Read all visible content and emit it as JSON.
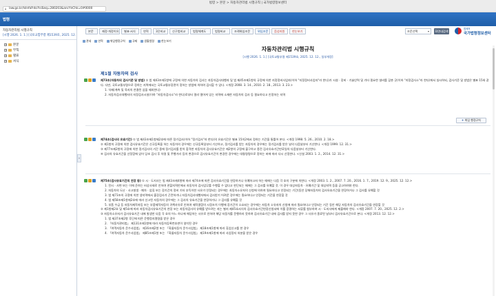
{
  "browser": {
    "tab_title": "법령 > 본문 > 자동차관리법 시행규칙 | 국가법령정보센터",
    "address": "law.go.kr/lsInfoP.do?lsiSeq=280203&ancYnChk=0#0000"
  },
  "header": {
    "menu": "법령"
  },
  "sidebar": {
    "title": "자동차관리법 시행규칙",
    "subtitle": "[시행 2026. 1. 1.] [국토교통부령 제1539호, 2025. 12.",
    "items": [
      {
        "label": "본문"
      },
      {
        "label": "부칙"
      },
      {
        "label": "별표"
      },
      {
        "label": "서식"
      }
    ],
    "collapse_icon": "«"
  },
  "toolbar": {
    "buttons": [
      {
        "label": "본문",
        "color": "normal"
      },
      {
        "label": "제정·개정이유",
        "color": "normal"
      },
      {
        "label": "별표·서식",
        "color": "normal"
      },
      {
        "label": "연혁",
        "color": "normal"
      },
      {
        "label": "3단비교",
        "color": "normal"
      },
      {
        "label": "신구법비교",
        "color": "normal"
      },
      {
        "label": "법령체계도",
        "color": "normal"
      },
      {
        "label": "법령비교",
        "color": "normal"
      },
      {
        "label": "조례위임조문",
        "color": "normal"
      },
      {
        "label": "위임조문",
        "color": "blue"
      },
      {
        "label": "음성지원",
        "color": "red"
      },
      {
        "label": "한눈보기",
        "color": "red"
      }
    ],
    "select_value": "조문선택",
    "go_label": "화면내검색",
    "logo_small": "법제처",
    "logo_main": "국가법령정보센터"
  },
  "sub_toolbar": [
    "관세",
    "연혁",
    "위임행정규칙",
    "규제",
    "생활법령",
    "한눈보기"
  ],
  "law": {
    "title": "자동차관리법 시행규칙",
    "subtitle": "[시행 2026. 1. 1.] [국토교통부령 제1539호, 2025. 12. 12., 일부개정]",
    "chapter": "제1절 자동차의 검사",
    "related_button": "위임 행정규칙"
  },
  "articles": [
    {
      "head": "제73조(자동차의 검사기준 및 방법)",
      "lines": [
        "① 법 제43조제1항에 규정에 의한 자동차의 검사는 자동차검사대행자 및 법 제45조제1항의 규정에 의한 지정정비사업자(이하 \"지정정비사업자\"라 한다)가 시설 · 장비 · 기술인력 및 기타 필요한 설비를 갖춘 곳(이하 \"지정검사소\"라 한다)에서 실시하되, 검사기준 및 방법은 별표 15와 같다. 다만, 국토교통부령으로 정하는 지역에서는 국토교통부장관이 정하는 방법에 의하여 검사할 수 있다. <개정 2008. 3. 14., 2010. 2. 18., 2013. 3. 23.>",
        "1. 삭제(계측 및 육지의 연결된 섬을 제외한다)",
        "2. 자동차검사대행자의 지정검사시설(이하 \"자동차검사소\"라 한다)로부터 멀리 떨어져 있는 지역에 소재한 자동차의 검사 등 필요하다고 인정하는 지역"
      ]
    },
    {
      "head": "제74조(검사의 유효기간)",
      "lines": [
        "① 법 제43조제1항제2호에 따른 정기검사(이하 \"정기검사\"라 한다)의 유효기간은 별표 15의2에서 정하는 기간을 통틀어 본다. <개정 1998. 5. 26., 2010. 2. 18.>",
        "② 제1항의 규정에 의한 검사유효기간은 신규등록을 하는 자동차의 경우에는 신규등록일부터 기산하고, 정기검사를 받는 자동차의 경우에는 정기검사를 받은 날의 다음날부터 기산한다. <개정 1999. 12. 31.>",
        "③ 제77조제2항의 규정에 의한 정기검사의 기간 중에 정기검사를 받아 합격한 자동차의 검사유효기간은 제2항의 규정에 불구하고 종전 검사유효기간만료일의 다음날부터 기산한다.",
        "④ 검사의 유효기간을 산정함에 있어 당초 검사 후 차령 및 주행거리 등의 변경으로 검사유효기간이 변경된 경우에는 대통령령으로 정하는 바에 따라 다시 산정한다. <신설 2003. 1. 2., 2014. 12. 31.>"
      ]
    },
    {
      "head": "제75조(검사유효기간의 연장 등)",
      "lines": [
        "① 시 · 도지사는 법 제43조제4항에 따라 제74조에 따른 검사유효기간을 연장하거나 유예하고자 하는 때에는 다음 각 호의 구분에 의한다. <개정 2003. 1. 2., 2007. 7. 20., 2016. 1. 7., 2019. 12. 9., 2025. 12. 12.>",
        "1. 전시 · 사변 또는 이에 준하는 비상사태로 인하여 관할지역안에서 자동차의 검사업무를 수행할 수 없다고 판단되는 때에는 그 검사를 유예할 것. 이 경우 대상자동차 · 유예기간 및 대상지역 등을 공고하여야 한다.",
        "2. 자동차의 도난 · 사고발생 · 폐차 · 압류 또는 장기간의 정비 기타 부득이한 사유가 인정되는 경우에는 자동차소유자의 신청에 의하여 필요하다고 인정되는 기간(동안 당해자동차의 검사유효기간을 연장하거나 그 검사를 유예할 것",
        "3. 법 제73조의 규정에 의한 생지역에서 출장검사가 곤란하거나 자동차검사대행자에서 검사받기 어려운 경우에는 필요하다고 인정되는 기간을 연장할 것",
        "4. 법 제58조제1항제2호에 따라 신고된 자동차의 경우에는 그 검사의 유효기간을 연장하거나 그 검사를 유예할 것",
        "5. 부품 수급 등 자동차제작자등 또는 부품제작자등의 귀책사유로 인하여 제작결함의 시정조치 이행에 장기간이 소요되는 경우에는 자동차 소유자의 신청에 따라 필요하다고 인정되는 기간 동안 해당 자동차의 검사유효기간을 연장할 것",
        "② 제1항제2호 및 제5호에 따라 자동차검사유효기간의 연장 또는 자동차검사의 유예를 받으려는 자는 별지 제45호서식의 검사유효기간연장신청서에 이를 증명하는 서류를 첨부하여 시 · 도지사에게 제출해야 한다. <개정 2007. 7. 20., 2025. 12. 2.>",
        "③ 자동차소유자가 검사유효기간 내에 발생한 다음 각 호의 어느 하나에 해당하는 사유로 인하여 해당 자동차를 운행하지 못하여 검사유효기간 내에 검사를 받지 못한 경우 그 사유가 종료된 날부터 검사유효기간으로 본다. <개정 2013. 12. 12.>",
        "1. 법 제37조제2항 후단에 따른 운행정지명령을 받은 경우",
        "2. 「자동차관리법」 제131조제1항에 따라 자동차등록번호판이 영치된 경우",
        "3. 「여객자동차 운수사업법」 제16조제2항 또는 「화물자동차 운수사업법」 제18조제1항에 따라 휴업신고를 한 경우",
        "4. 「여객자동차 운수사업법」 제85조제1항 또는 「화물자동차 운수사업법」 제19조제1항에 따라 사업정지 처분을 받은 경우"
      ]
    }
  ]
}
